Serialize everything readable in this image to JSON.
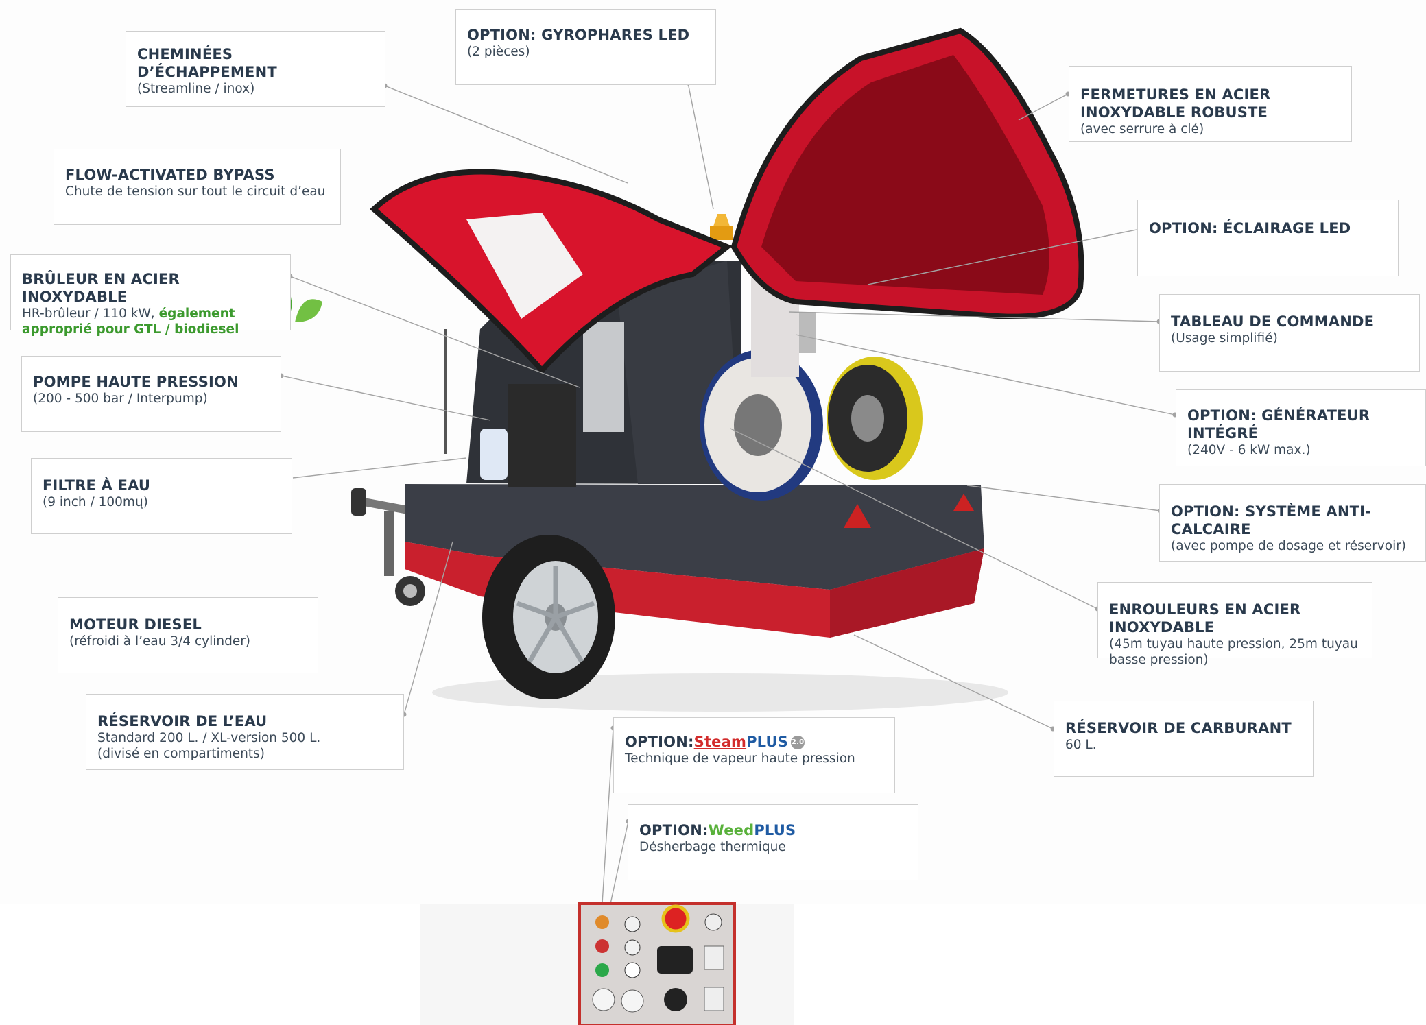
{
  "labels": {
    "exhaust": {
      "title": "CHEMINÉES  D’ÉCHAPPEMENT",
      "sub": "(Streamline / inox)"
    },
    "beacons": {
      "title": "OPTION: GYROPHARES LED",
      "sub": "(2 pièces)"
    },
    "locks": {
      "title_line1": "FERMETURES EN ACIER",
      "title_line2": "INOXYDABLE  ROBUSTE",
      "sub": "(avec serrure à clé)"
    },
    "bypass": {
      "title": "FLOW-ACTIVATED BYPASS",
      "sub": "Chute de tension sur tout le circuit d’eau"
    },
    "lighting": {
      "title": "OPTION:  ÉCLAIRAGE  LED"
    },
    "burner": {
      "title": "BRÛLEUR EN ACIER INOXYDABLE",
      "sub_a": "HR-brûleur / 110 kW, ",
      "sub_green1": "également",
      "sub_green2": "approprié pour GTL / biodiesel"
    },
    "control_panel": {
      "title": "TABLEAU  DE  COMMANDE",
      "sub": "(Usage  simplifié)"
    },
    "pump": {
      "title": "POMPE HAUTE PRESSION",
      "sub": "(200 - 500 bar / Interpump)"
    },
    "generator": {
      "title": "OPTION: GÉNÉRATEUR INTÉGRÉ",
      "sub": "(240V - 6 kW max.)"
    },
    "filter": {
      "title": "FILTRE À EAU",
      "sub": "(9 inch / 100mų)"
    },
    "anticalc": {
      "title": "OPTION: SYSTÈME ANTI-CALCAIRE",
      "sub": "(avec pompe de dosage et réservoir)"
    },
    "engine": {
      "title": "MOTEUR  DIESEL",
      "sub": "(réfroidi à l’eau 3/4 cylinder)"
    },
    "reels": {
      "title": "ENROULEURS EN ACIER INOXYDABLE",
      "sub1": "(45m tuyau haute pression, 25m tuyau",
      "sub2": "basse pression)"
    },
    "water_tank": {
      "title": "RÉSERVOIR DE L’EAU",
      "sub1": "Standard 200 L. / XL-version 500 L.",
      "sub2": "(divisé en compartiments)"
    },
    "fuel_tank": {
      "title": "RÉSERVOIR DE CARBURANT",
      "sub": "60 L."
    },
    "steamplus": {
      "prefix": "OPTION:",
      "brand_a": "Steam",
      "brand_b": "PLUS",
      "badge": "2.0",
      "sub": "Technique de vapeur haute pression"
    },
    "weedplus": {
      "prefix": "OPTION:",
      "brand_a": "Weed",
      "brand_b": "PLUS",
      "sub": "Désherbage thermique"
    }
  },
  "colors": {
    "hood_red": "#d8142c",
    "body_dark": "#3a3d45",
    "accent_green": "#3c9a2e",
    "leader_line": "#9a9a9a"
  }
}
